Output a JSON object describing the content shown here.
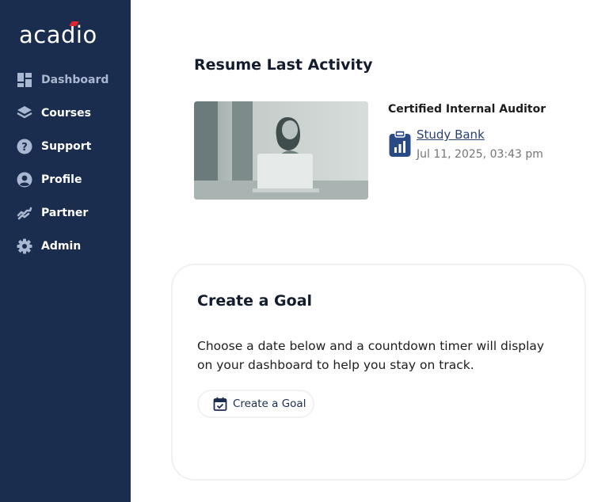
{
  "brand": {
    "logo_text": "acadio",
    "accent_color": "#e0242f",
    "sidebar_color": "#1b2d4f"
  },
  "sidebar": {
    "items": [
      {
        "label": "Dashboard",
        "icon": "dashboard-icon",
        "active": true
      },
      {
        "label": "Courses",
        "icon": "layers-icon",
        "active": false
      },
      {
        "label": "Support",
        "icon": "help-icon",
        "active": false
      },
      {
        "label": "Profile",
        "icon": "user-icon",
        "active": false
      },
      {
        "label": "Partner",
        "icon": "handshake-icon",
        "active": false
      },
      {
        "label": "Admin",
        "icon": "gear-icon",
        "active": false
      }
    ]
  },
  "resume": {
    "title": "Resume Last Activity",
    "course_name": "Certified Internal Auditor",
    "resource_label": "Study Bank",
    "resource_icon": "clipboard-chart-icon",
    "timestamp": "Jul 11, 2025, 03:43 pm"
  },
  "goal": {
    "title": "Create a Goal",
    "description": "Choose a date below and a countdown timer will display on your dashboard to help you stay on track.",
    "button_label": "Create a Goal",
    "button_icon": "calendar-check-icon"
  }
}
